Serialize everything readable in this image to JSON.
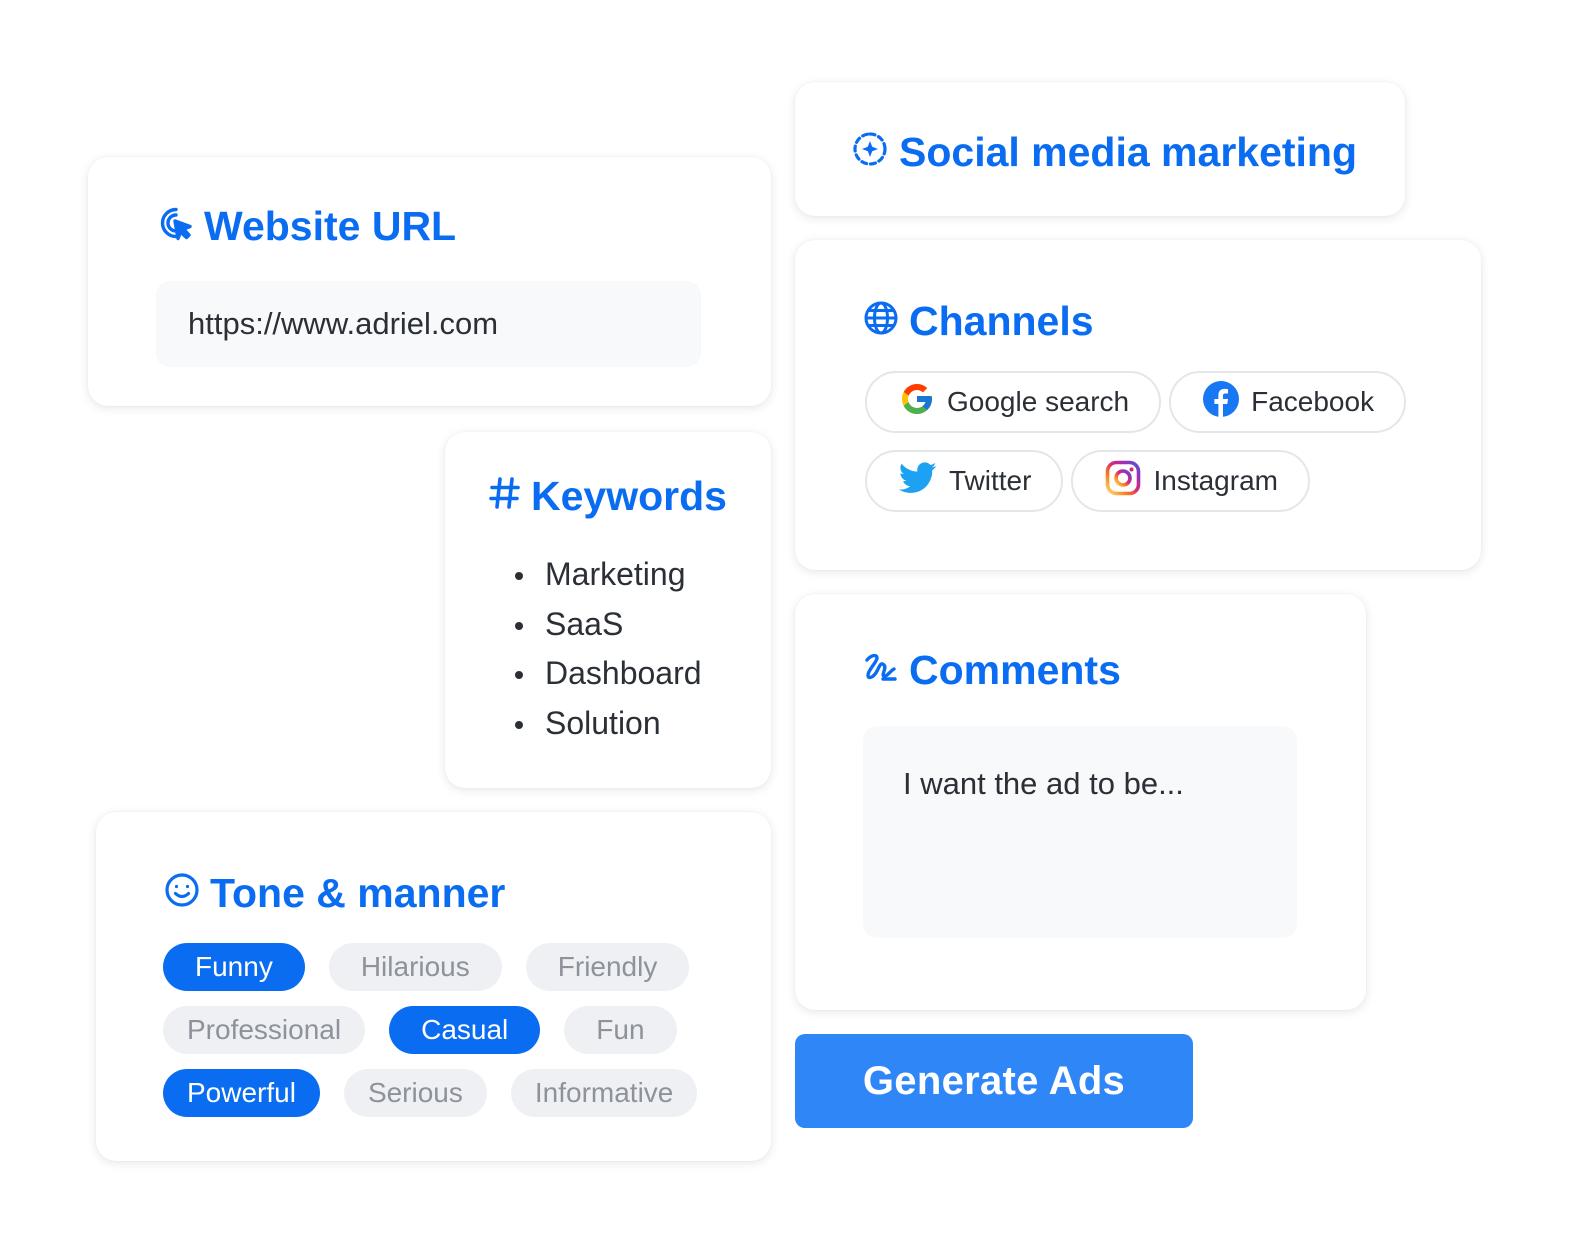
{
  "accent_color": "#0a6cf0",
  "website_url": {
    "title": "Website URL",
    "icon": "cursor-click-icon",
    "value": "https://www.adriel.com"
  },
  "keywords": {
    "title": "Keywords",
    "icon": "hash-icon",
    "items": [
      "Marketing",
      "SaaS",
      "Dashboard",
      "Solution"
    ]
  },
  "tone": {
    "title": "Tone & manner",
    "icon": "smiley-icon",
    "rows": [
      [
        {
          "label": "Funny",
          "selected": true
        },
        {
          "label": "Hilarious",
          "selected": false
        },
        {
          "label": "Friendly",
          "selected": false
        }
      ],
      [
        {
          "label": "Professional",
          "selected": false
        },
        {
          "label": "Casual",
          "selected": true
        },
        {
          "label": "Fun",
          "selected": false
        }
      ],
      [
        {
          "label": "Powerful",
          "selected": true
        },
        {
          "label": "Serious",
          "selected": false
        },
        {
          "label": "Informative",
          "selected": false
        }
      ]
    ]
  },
  "social": {
    "title": "Social media marketing",
    "icon": "sparkle-circle-icon"
  },
  "channels": {
    "title": "Channels",
    "icon": "globe-icon",
    "items": [
      {
        "label": "Google search",
        "icon": "google-icon"
      },
      {
        "label": "Facebook",
        "icon": "facebook-icon"
      },
      {
        "label": "Twitter",
        "icon": "twitter-icon"
      },
      {
        "label": "Instagram",
        "icon": "instagram-icon"
      }
    ]
  },
  "comments": {
    "title": "Comments",
    "icon": "signature-icon",
    "placeholder": "I want the ad to be..."
  },
  "generate_button": {
    "label": "Generate Ads",
    "color": "#2e86f7"
  }
}
